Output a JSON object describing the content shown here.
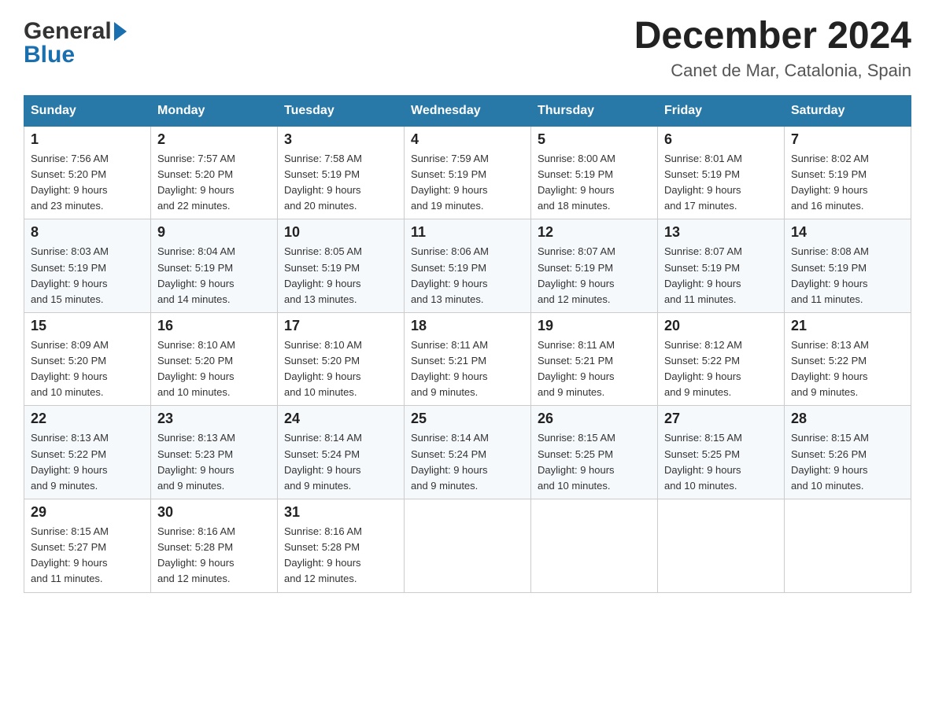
{
  "logo": {
    "general": "General",
    "blue": "Blue"
  },
  "title": "December 2024",
  "subtitle": "Canet de Mar, Catalonia, Spain",
  "days_of_week": [
    "Sunday",
    "Monday",
    "Tuesday",
    "Wednesday",
    "Thursday",
    "Friday",
    "Saturday"
  ],
  "weeks": [
    [
      {
        "num": "1",
        "sunrise": "7:56 AM",
        "sunset": "5:20 PM",
        "daylight": "9 hours and 23 minutes."
      },
      {
        "num": "2",
        "sunrise": "7:57 AM",
        "sunset": "5:20 PM",
        "daylight": "9 hours and 22 minutes."
      },
      {
        "num": "3",
        "sunrise": "7:58 AM",
        "sunset": "5:19 PM",
        "daylight": "9 hours and 20 minutes."
      },
      {
        "num": "4",
        "sunrise": "7:59 AM",
        "sunset": "5:19 PM",
        "daylight": "9 hours and 19 minutes."
      },
      {
        "num": "5",
        "sunrise": "8:00 AM",
        "sunset": "5:19 PM",
        "daylight": "9 hours and 18 minutes."
      },
      {
        "num": "6",
        "sunrise": "8:01 AM",
        "sunset": "5:19 PM",
        "daylight": "9 hours and 17 minutes."
      },
      {
        "num": "7",
        "sunrise": "8:02 AM",
        "sunset": "5:19 PM",
        "daylight": "9 hours and 16 minutes."
      }
    ],
    [
      {
        "num": "8",
        "sunrise": "8:03 AM",
        "sunset": "5:19 PM",
        "daylight": "9 hours and 15 minutes."
      },
      {
        "num": "9",
        "sunrise": "8:04 AM",
        "sunset": "5:19 PM",
        "daylight": "9 hours and 14 minutes."
      },
      {
        "num": "10",
        "sunrise": "8:05 AM",
        "sunset": "5:19 PM",
        "daylight": "9 hours and 13 minutes."
      },
      {
        "num": "11",
        "sunrise": "8:06 AM",
        "sunset": "5:19 PM",
        "daylight": "9 hours and 13 minutes."
      },
      {
        "num": "12",
        "sunrise": "8:07 AM",
        "sunset": "5:19 PM",
        "daylight": "9 hours and 12 minutes."
      },
      {
        "num": "13",
        "sunrise": "8:07 AM",
        "sunset": "5:19 PM",
        "daylight": "9 hours and 11 minutes."
      },
      {
        "num": "14",
        "sunrise": "8:08 AM",
        "sunset": "5:19 PM",
        "daylight": "9 hours and 11 minutes."
      }
    ],
    [
      {
        "num": "15",
        "sunrise": "8:09 AM",
        "sunset": "5:20 PM",
        "daylight": "9 hours and 10 minutes."
      },
      {
        "num": "16",
        "sunrise": "8:10 AM",
        "sunset": "5:20 PM",
        "daylight": "9 hours and 10 minutes."
      },
      {
        "num": "17",
        "sunrise": "8:10 AM",
        "sunset": "5:20 PM",
        "daylight": "9 hours and 10 minutes."
      },
      {
        "num": "18",
        "sunrise": "8:11 AM",
        "sunset": "5:21 PM",
        "daylight": "9 hours and 9 minutes."
      },
      {
        "num": "19",
        "sunrise": "8:11 AM",
        "sunset": "5:21 PM",
        "daylight": "9 hours and 9 minutes."
      },
      {
        "num": "20",
        "sunrise": "8:12 AM",
        "sunset": "5:22 PM",
        "daylight": "9 hours and 9 minutes."
      },
      {
        "num": "21",
        "sunrise": "8:13 AM",
        "sunset": "5:22 PM",
        "daylight": "9 hours and 9 minutes."
      }
    ],
    [
      {
        "num": "22",
        "sunrise": "8:13 AM",
        "sunset": "5:22 PM",
        "daylight": "9 hours and 9 minutes."
      },
      {
        "num": "23",
        "sunrise": "8:13 AM",
        "sunset": "5:23 PM",
        "daylight": "9 hours and 9 minutes."
      },
      {
        "num": "24",
        "sunrise": "8:14 AM",
        "sunset": "5:24 PM",
        "daylight": "9 hours and 9 minutes."
      },
      {
        "num": "25",
        "sunrise": "8:14 AM",
        "sunset": "5:24 PM",
        "daylight": "9 hours and 9 minutes."
      },
      {
        "num": "26",
        "sunrise": "8:15 AM",
        "sunset": "5:25 PM",
        "daylight": "9 hours and 10 minutes."
      },
      {
        "num": "27",
        "sunrise": "8:15 AM",
        "sunset": "5:25 PM",
        "daylight": "9 hours and 10 minutes."
      },
      {
        "num": "28",
        "sunrise": "8:15 AM",
        "sunset": "5:26 PM",
        "daylight": "9 hours and 10 minutes."
      }
    ],
    [
      {
        "num": "29",
        "sunrise": "8:15 AM",
        "sunset": "5:27 PM",
        "daylight": "9 hours and 11 minutes."
      },
      {
        "num": "30",
        "sunrise": "8:16 AM",
        "sunset": "5:28 PM",
        "daylight": "9 hours and 12 minutes."
      },
      {
        "num": "31",
        "sunrise": "8:16 AM",
        "sunset": "5:28 PM",
        "daylight": "9 hours and 12 minutes."
      },
      null,
      null,
      null,
      null
    ]
  ],
  "labels": {
    "sunrise": "Sunrise:",
    "sunset": "Sunset:",
    "daylight": "Daylight:"
  }
}
